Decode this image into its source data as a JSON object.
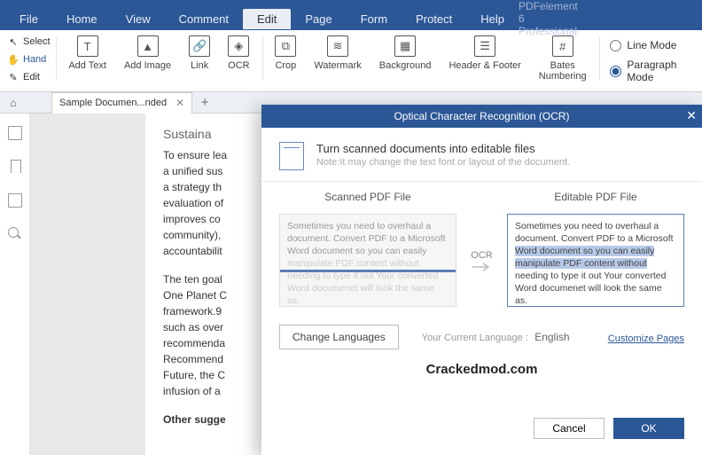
{
  "app_title": "PDFelement 6 Professional",
  "menu": {
    "file": "File",
    "home": "Home",
    "view": "View",
    "comment": "Comment",
    "edit": "Edit",
    "page": "Page",
    "form": "Form",
    "protect": "Protect",
    "help": "Help"
  },
  "sidetools": {
    "select": "Select",
    "hand": "Hand",
    "edit": "Edit"
  },
  "ribbon": {
    "add_text": "Add Text",
    "add_image": "Add Image",
    "link": "Link",
    "ocr": "OCR",
    "crop": "Crop",
    "watermark": "Watermark",
    "background": "Background",
    "header_footer": "Header & Footer",
    "bates": "Bates\nNumbering"
  },
  "mode": {
    "line": "Line Mode",
    "para": "Paragraph Mode"
  },
  "tab": {
    "name": "Sample Documen...nded",
    "new": "+"
  },
  "doc": {
    "heading": "Sustaina",
    "p1": "To ensure lea",
    "p2": "a unified sus",
    "p3": "a strategy th",
    "p4": "evaluation of",
    "p5": "improves co",
    "p6": "community),",
    "p7": "accountabilit",
    "g1": "The ten goal",
    "g2": "One Planet C",
    "g3": "framework.9",
    "g4": "such as over",
    "g5": "recommenda",
    "g6": "Recommend",
    "g7": "Future, the C",
    "g8": "infusion of a",
    "other": "Other sugge"
  },
  "ocr": {
    "title": "Optical Character Recognition (OCR)",
    "head": "Turn scanned documents into editable files",
    "sub": "Note:It may change the text font or layout of the document.",
    "scanned": "Scanned PDF File",
    "editable": "Editable PDF File",
    "arrow": "OCR",
    "sample": "Sometimes you need to overhaul a document. Convert PDF to a Microsoft Word document so you can easily ",
    "sample_ghost": "manipulate PDF content without",
    "sample_tail": "needing to type it out Your converted Word documenet will look the same as.",
    "hl1": "Word document so you can easily",
    "hl2": "manipulate PDF content without",
    "change_lang": "Change Languages",
    "lang_hint": "Your Current Language :",
    "lang": "English",
    "customize": "Customize Pages",
    "watermark": "Crackedmod.com",
    "cancel": "Cancel",
    "ok": "OK"
  }
}
